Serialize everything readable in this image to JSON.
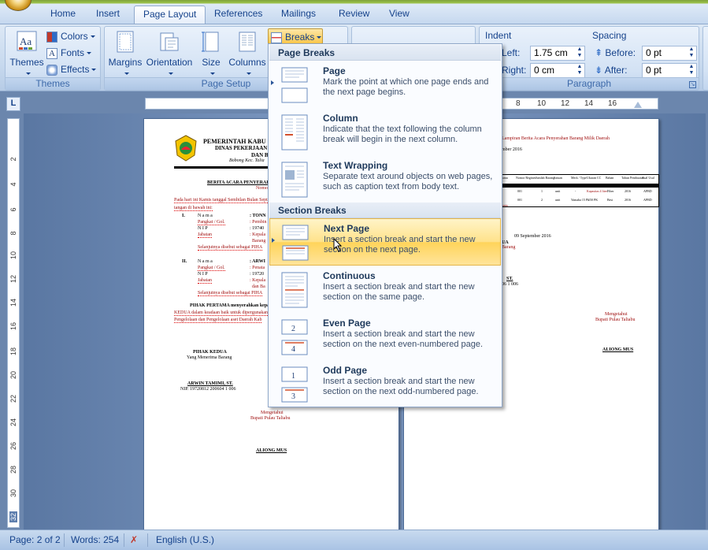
{
  "tabs": [
    {
      "label": "Home",
      "active": false
    },
    {
      "label": "Insert",
      "active": false
    },
    {
      "label": "Page Layout",
      "active": true
    },
    {
      "label": "References",
      "active": false
    },
    {
      "label": "Mailings",
      "active": false
    },
    {
      "label": "Review",
      "active": false
    },
    {
      "label": "View",
      "active": false
    }
  ],
  "ribbon": {
    "themes_group": {
      "label": "Themes",
      "themes_button": "Themes",
      "colors": "Colors",
      "fonts": "Fonts",
      "effects": "Effects"
    },
    "page_setup_group": {
      "label": "Page Setup",
      "margins": "Margins",
      "orientation": "Orientation",
      "size": "Size",
      "columns": "Columns",
      "breaks": "Breaks"
    },
    "paragraph_group": {
      "label": "Paragraph",
      "indent_title": "Indent",
      "left_label": "Left:",
      "left_value": "1.75 cm",
      "right_label": "Right:",
      "right_value": "0 cm",
      "spacing_title": "Spacing",
      "before_label": "Before:",
      "before_value": "0 pt",
      "after_label": "After:",
      "after_value": "0 pt"
    }
  },
  "ruler": {
    "h_ticks": [
      "8",
      "10",
      "12",
      "14",
      "16"
    ],
    "v_ticks": [
      "2",
      "4",
      "6",
      "8",
      "10",
      "12",
      "14",
      "16",
      "18",
      "20",
      "22",
      "24",
      "26",
      "28",
      "30",
      "32"
    ],
    "corner": "L"
  },
  "breaks_menu": {
    "page_breaks_header": "Page Breaks",
    "section_breaks_header": "Section Breaks",
    "items": [
      {
        "title": "Page",
        "desc": "Mark the point at which one page ends and the next page begins."
      },
      {
        "title": "Column",
        "desc": "Indicate that the text following the column break will begin in the next column."
      },
      {
        "title": "Text Wrapping",
        "desc": "Separate text around objects on web pages, such as caption text from body text."
      },
      {
        "title": "Next Page",
        "desc": "Insert a section break and start the new section on the next page."
      },
      {
        "title": "Continuous",
        "desc": "Insert a section break and start the new section on the same page."
      },
      {
        "title": "Even Page",
        "desc": "Insert a section break and start the new section on the next even-numbered page."
      },
      {
        "title": "Odd Page",
        "desc": "Insert a section break and start the new section on the next odd-numbered page."
      }
    ],
    "even_icon_digits": [
      "2",
      "4"
    ],
    "odd_icon_digits": [
      "1",
      "3"
    ]
  },
  "document": {
    "page1": {
      "header1": "PEMERINTAH KABU",
      "header2": "DINAS PEKERJAAN",
      "header3": "DAN BEN",
      "header4": "Bobong Kec. Talia",
      "title": "BERITA ACARA PENYERAH",
      "subtitle": "Nomor :",
      "intro": "Pada hari ini Kamis tanggal Sembilan Bulan Sept",
      "intro2": "tangan di bawah ini:",
      "p1_num": "I.",
      "p1_lines": [
        "N a m a",
        "Pangkat / Gol.",
        "N I P",
        "Jabatan"
      ],
      "p1_values": [
        ": TONN",
        ": Pembin",
        ": 19740",
        ": Kepala",
        "Barang"
      ],
      "p1_after": "Selanjutnya disebut sebagai PIHA",
      "p2_num": "II.",
      "p2_lines": [
        "N a m a",
        "Pangkat / Gol.",
        "N I P",
        "Jabatan"
      ],
      "p2_values": [
        ": ARWI",
        ": Penata",
        ": 19720",
        ": Kepala",
        "dan Ba"
      ],
      "p2_after": "Selanjutnya disebut sebagai PIHA",
      "para1": "PIHAK PERTAMA menyerahkan kepada",
      "para2": "KEDUA dalam keadaan baik untuk dipergunakan",
      "para3": "Pengelolaan dan Pengelolaan aset Daerah Kab",
      "sig_title": "PIHAK KEDUA",
      "sig_sub": "Yang Menerima Barang",
      "sig_name": "ARWIN TAMIMI, ST.",
      "sig_nip": "NIP. 19720812 200604 1 006",
      "know": "Mengetahui",
      "know2": "Bupati Pulau Taliabu",
      "bupati": "ALIONG MUS"
    },
    "page2": {
      "line1": "Lampiran Berita Acara Penyerahan Barang Milik Daerah",
      "line2": "mber 2016",
      "table_headers": [
        "ama",
        "Nomor Register",
        "Jumlah Barang",
        "Satuan",
        "Merk / Type",
        "Ukuran CC",
        "Bahan",
        "Tahun Pembuatan",
        "Asal Usul"
      ],
      "row1": [
        "",
        "001",
        "1",
        "unit",
        "-",
        "Kapasitas 4 liter",
        "Fiber",
        "2016",
        "APBD"
      ],
      "row2": [
        "",
        "001",
        "2",
        "unit",
        "Yamaha 15 Pk",
        "150 PK",
        "Besi",
        "2016",
        "APBD"
      ],
      "row_extra": "anta",
      "date": "09 September 2016",
      "rec1": "UA",
      "rec2": "Barang",
      "name": "ST.",
      "nip": "06 1 006",
      "know": "Mengetahui",
      "know2": "Bupati Pulau Taliabu",
      "bupati": "ALIONG MUS"
    }
  },
  "statusbar": {
    "page": "Page: 2 of 2",
    "words": "Words: 254",
    "language": "English (U.S.)"
  }
}
